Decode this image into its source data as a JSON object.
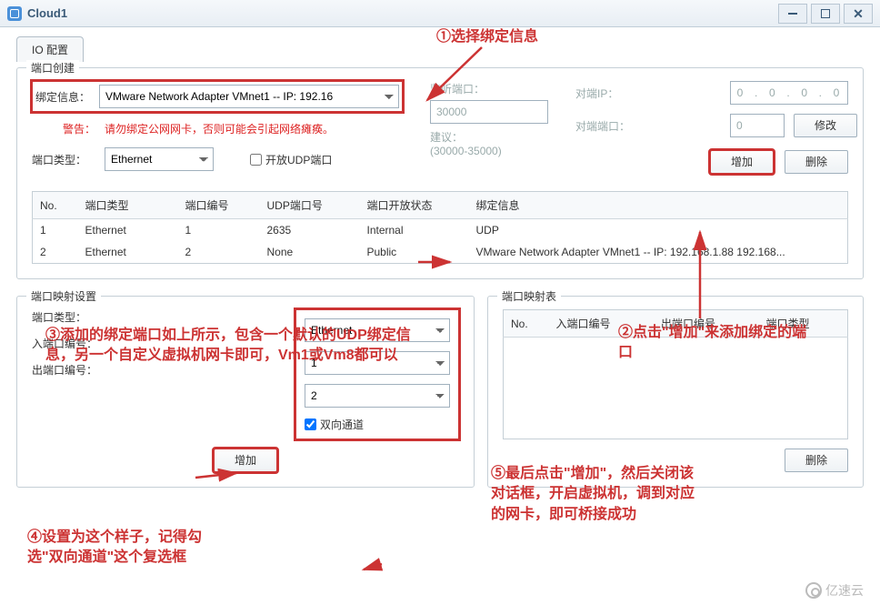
{
  "window": {
    "title": "Cloud1"
  },
  "tabs": {
    "io_config": "IO 配置"
  },
  "port_creation": {
    "legend": "端口创建",
    "bind_label": "绑定信息：",
    "bind_value": "VMware Network Adapter VMnet1 -- IP: 192.16",
    "warn_label": "警告：",
    "warn_text": "请勿绑定公网网卡，否则可能会引起网络瘫痪。",
    "port_type_label": "端口类型：",
    "port_type_value": "Ethernet",
    "open_udp_label": "开放UDP端口",
    "listen_label": "监听端口：",
    "listen_value": "30000",
    "hint_label": "建议：",
    "hint_range": "(30000-35000)",
    "peer_ip_label": "对端IP：",
    "peer_ip_value": "0  .  0  .  0  .  0",
    "peer_port_label": "对端端口：",
    "peer_port_value": "0",
    "modify_btn": "修改",
    "add_btn": "增加",
    "delete_btn": "删除"
  },
  "port_table": {
    "headers": {
      "no": "No.",
      "type": "端口类型",
      "portno": "端口编号",
      "udp": "UDP端口号",
      "state": "端口开放状态",
      "bind": "绑定信息"
    },
    "rows": [
      {
        "no": "1",
        "type": "Ethernet",
        "portno": "1",
        "udp": "2635",
        "state": "Internal",
        "bind": "UDP"
      },
      {
        "no": "2",
        "type": "Ethernet",
        "portno": "2",
        "udp": "None",
        "state": "Public",
        "bind": "VMware Network Adapter VMnet1 -- IP: 192.168.1.88 192.168..."
      }
    ]
  },
  "port_map_settings": {
    "legend": "端口映射设置",
    "type_label": "端口类型：",
    "type_value": "Ethernet",
    "in_label": "入端口编号：",
    "in_value": "1",
    "out_label": "出端口编号：",
    "out_value": "2",
    "duplex_label": "双向通道",
    "add_btn": "增加"
  },
  "port_map_table": {
    "legend": "端口映射表",
    "headers": {
      "no": "No.",
      "in": "入端口编号",
      "out": "出端口编号",
      "type": "端口类型"
    },
    "delete_btn": "删除"
  },
  "annotations": {
    "a1": "①选择绑定信息",
    "a2": "②点击\"增加\"来添加绑定的端口",
    "a3": "③添加的绑定端口如上所示，包含一个默认的UDP绑定信息，另一个自定义虚拟机网卡即可，Vm1或Vm8都可以",
    "a4": "④设置为这个样子，记得勾选\"双向通道\"这个复选框",
    "a5": "⑤最后点击\"增加\"，然后关闭该对话框，开启虚拟机，调到对应的网卡，即可桥接成功"
  },
  "watermark": "亿速云"
}
